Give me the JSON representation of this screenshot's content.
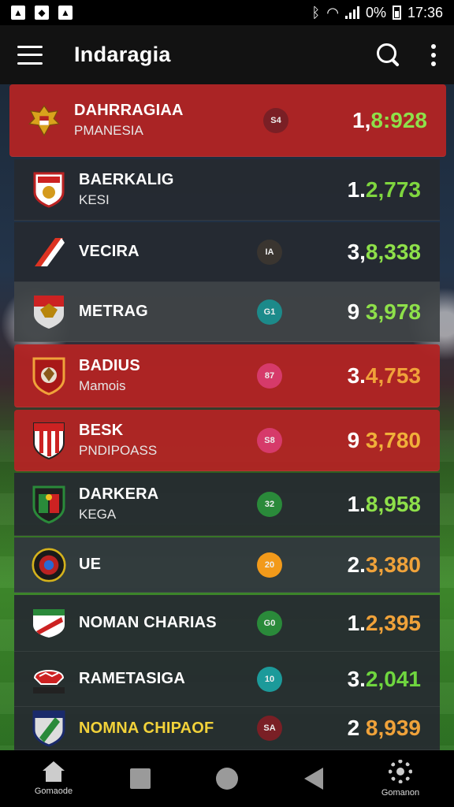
{
  "status_bar": {
    "battery": "0%",
    "time": "17:36",
    "left_icons": [
      "image-icon",
      "video-icon",
      "photo-icon"
    ]
  },
  "app_bar": {
    "title": "Indaragia"
  },
  "rows": [
    {
      "name": "DAHRRAGIAA",
      "sub": "PMANESIA",
      "badge": "S4",
      "badge_color": "#7a1f25",
      "score_lead": "1,",
      "score_rest": "8:928",
      "score_color": "#8ee04a",
      "bg": "red",
      "crest": "garuda"
    },
    {
      "name": "BAERKALIG",
      "sub": "KESI",
      "badge": "",
      "badge_color": "",
      "score_lead": "1.",
      "score_rest": "2,773",
      "score_color": "#7fd63f",
      "bg": "dark",
      "crest": "shield-red"
    },
    {
      "name": "VECIRA",
      "sub": "",
      "badge": "IA",
      "badge_color": "#3a3530",
      "score_lead": "3,",
      "score_rest": "8,338",
      "score_color": "#8ee04a",
      "bg": "dark",
      "crest": "stripe"
    },
    {
      "name": "METRAG",
      "sub": "",
      "badge": "G1",
      "badge_color": "#1c8a8a",
      "score_lead": "9 ",
      "score_rest": "3,978",
      "score_color": "#8ee04a",
      "bg": "grey",
      "crest": "shield-eagle"
    },
    {
      "name": "BADIUS",
      "sub": "Mamois",
      "badge": "87",
      "badge_color": "#d63a6a",
      "score_lead": "3.",
      "score_rest": "4,753",
      "score_color": "#f0a23a",
      "bg": "red",
      "crest": "shield-orange"
    },
    {
      "name": "BESK",
      "sub": "PNDIPOASS",
      "badge": "S8",
      "badge_color": "#d63a6a",
      "score_lead": "9 ",
      "score_rest": "3,780",
      "score_color": "#f0b03a",
      "bg": "red",
      "crest": "shield-stripes"
    },
    {
      "name": "DARKERA",
      "sub": "KEGA",
      "badge": "32",
      "badge_color": "#2a8a3a",
      "score_lead": "1.",
      "score_rest": "8,958",
      "score_color": "#8ee04a",
      "bg": "dark",
      "crest": "shield-green"
    },
    {
      "name": "UE",
      "sub": "",
      "badge": "20",
      "badge_color": "#f29a1a",
      "score_lead": "2.",
      "score_rest": "3,380",
      "score_color": "#f0a23a",
      "bg": "slate",
      "crest": "round-badge"
    },
    {
      "name": "NOMAN CHARIAS",
      "sub": "",
      "badge": "G0",
      "badge_color": "#2a8a3a",
      "score_lead": "1.",
      "score_rest": "2,395",
      "score_color": "#f0a23a",
      "bg": "dark",
      "crest": "shield-redwhite"
    },
    {
      "name": "RAMETASIGA",
      "sub": "",
      "badge": "10",
      "badge_color": "#1c9a9a",
      "score_lead": "3.",
      "score_rest": "2,041",
      "score_color": "#6fd63f",
      "bg": "dark",
      "crest": "zigzag"
    },
    {
      "name": "NOMNA CHIPAOF",
      "sub": "",
      "badge": "SA",
      "badge_color": "#7a1f25",
      "score_lead": "2 ",
      "score_rest": "8,939",
      "score_color": "#f0a23a",
      "bg": "dark",
      "crest": "shield-dark",
      "name_color": "#f2d23a"
    }
  ],
  "nav_bar": {
    "left_label": "Gomaode",
    "right_label": "Gomanon"
  }
}
